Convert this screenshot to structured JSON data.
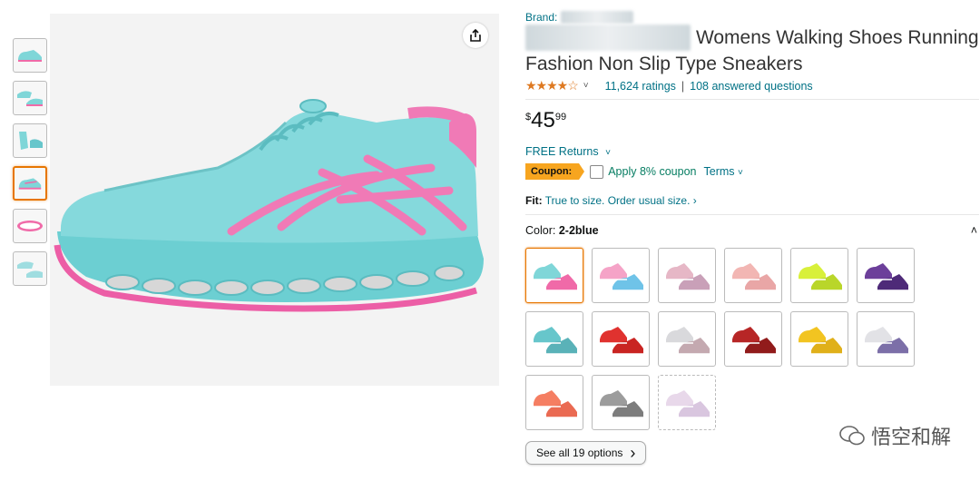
{
  "brand": {
    "label": "Brand:",
    "value": ""
  },
  "product": {
    "title": "Womens Walking Shoes Running Fashion Non Slip Type Sneakers",
    "stars_text": "★★★★☆",
    "ratings": "11,624 ratings",
    "separator": "|",
    "answered": "108 answered questions"
  },
  "price": {
    "currency": "$",
    "whole": "45",
    "fraction": "99"
  },
  "returns": {
    "label": "FREE Returns",
    "chevron": "˅"
  },
  "coupon": {
    "badge": "Coupon:",
    "text": "Apply 8% coupon",
    "terms": "Terms",
    "chevron": "˅"
  },
  "fit": {
    "label": "Fit:",
    "text": "True to size. Order usual size.",
    "arrow": "›"
  },
  "color": {
    "label": "Color:",
    "value": "2-2blue",
    "chevron": "˄"
  },
  "swatches": [
    {
      "c1": "#7fd6d8",
      "c2": "#f06aa8"
    },
    {
      "c1": "#f5a3c7",
      "c2": "#6fc3e8"
    },
    {
      "c1": "#e6b7c6",
      "c2": "#c9a0b8"
    },
    {
      "c1": "#f2b6b3",
      "c2": "#e9a6a6"
    },
    {
      "c1": "#d8f03a",
      "c2": "#b9d62a"
    },
    {
      "c1": "#6c3f9a",
      "c2": "#4e2a78"
    },
    {
      "c1": "#67c6cb",
      "c2": "#5ab2b8"
    },
    {
      "c1": "#e0322f",
      "c2": "#c92422"
    },
    {
      "c1": "#d9d9dc",
      "c2": "#c4a9b0"
    },
    {
      "c1": "#b72626",
      "c2": "#911b1b"
    },
    {
      "c1": "#f2c421",
      "c2": "#e0b01a"
    },
    {
      "c1": "#e2e2e6",
      "c2": "#7c6fa8"
    },
    {
      "c1": "#f57e62",
      "c2": "#ea6a52"
    },
    {
      "c1": "#9c9c9c",
      "c2": "#7d7d7d"
    },
    {
      "c1": "#e8d8ea",
      "c2": "#d9c6df"
    }
  ],
  "see_all": {
    "label": "See all 19 options",
    "arrow": "›"
  },
  "watermark": {
    "text": "悟空和解"
  },
  "colors": {
    "link": "#007185",
    "accent": "#e77600",
    "coupon": "#f7a51f",
    "star": "#de7921",
    "coupon_text": "#067d62"
  }
}
